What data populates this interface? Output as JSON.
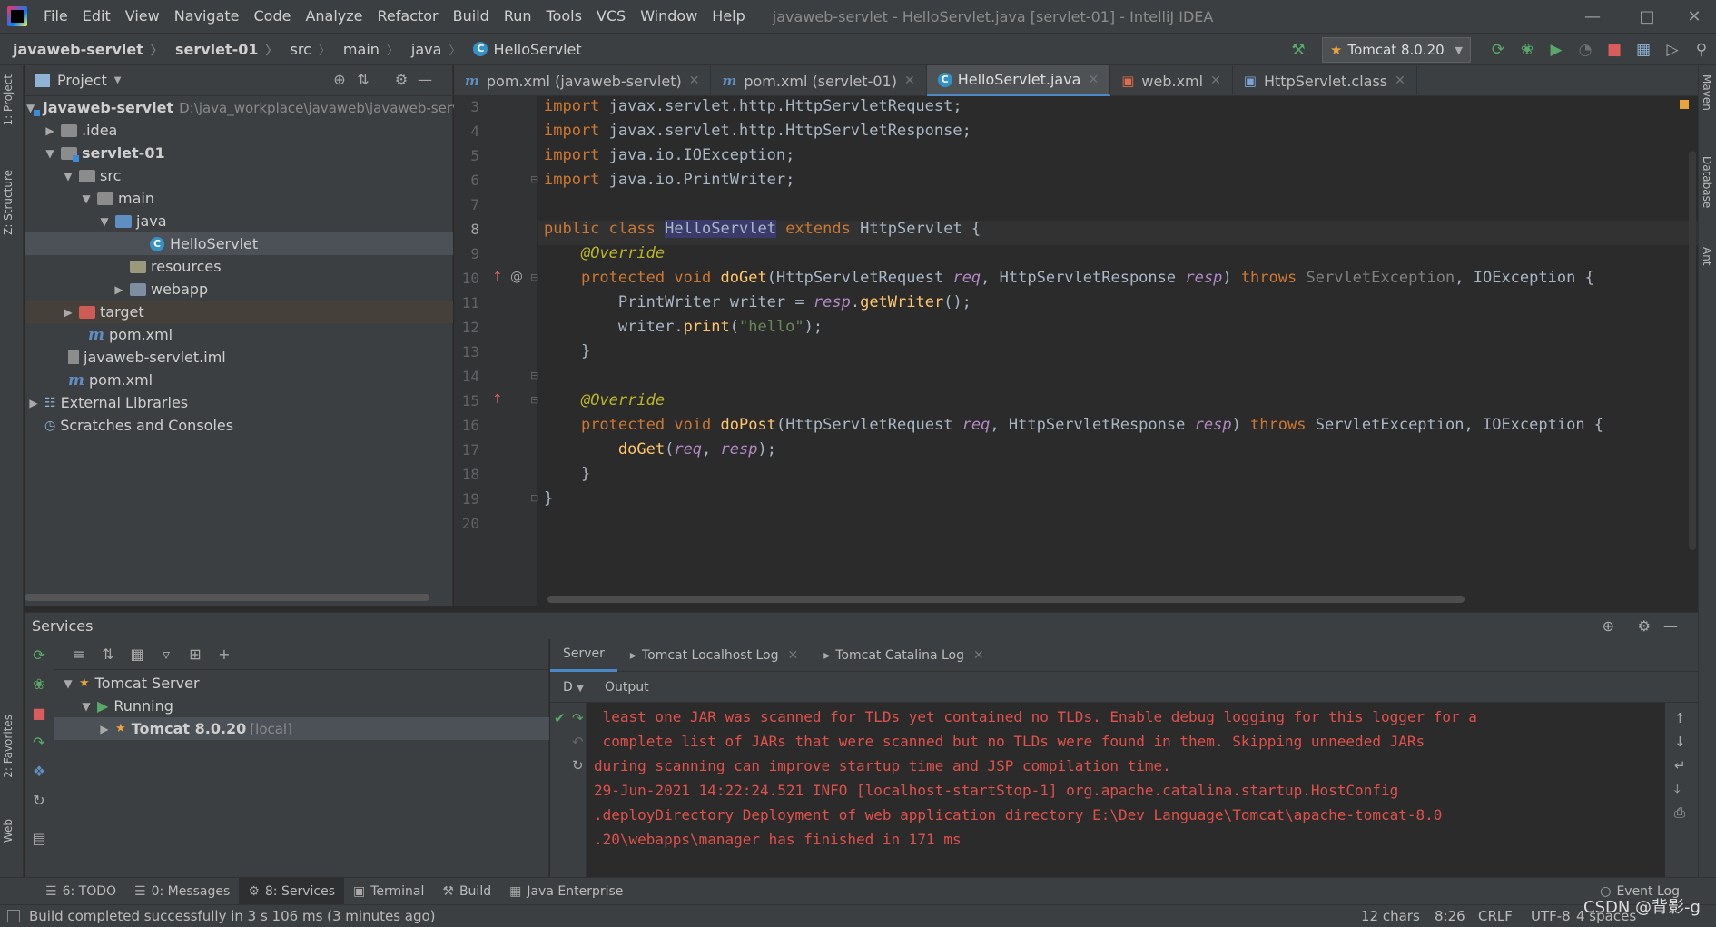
{
  "window": {
    "title": "javaweb-servlet - HelloServlet.java [servlet-01] - IntelliJ IDEA",
    "menu": [
      "File",
      "Edit",
      "View",
      "Navigate",
      "Code",
      "Analyze",
      "Refactor",
      "Build",
      "Run",
      "Tools",
      "VCS",
      "Window",
      "Help"
    ]
  },
  "breadcrumb": [
    "javaweb-servlet",
    "servlet-01",
    "src",
    "main",
    "java",
    "HelloServlet"
  ],
  "run_config": "Tomcat 8.0.20",
  "vertical_tabs": {
    "left": [
      "1: Project",
      "Z: Structure",
      "2: Favorites",
      "Web"
    ],
    "right": [
      "Maven",
      "Database",
      "Ant"
    ]
  },
  "project": {
    "header": "Project",
    "tree": [
      {
        "label": "javaweb-servlet",
        "path": "D:\\java_workplace\\javaweb\\javaweb-serv"
      },
      {
        "label": ".idea"
      },
      {
        "label": "servlet-01"
      },
      {
        "label": "src"
      },
      {
        "label": "main"
      },
      {
        "label": "java"
      },
      {
        "label": "HelloServlet"
      },
      {
        "label": "resources"
      },
      {
        "label": "webapp"
      },
      {
        "label": "target"
      },
      {
        "label": "pom.xml"
      },
      {
        "label": "javaweb-servlet.iml"
      },
      {
        "label": "pom.xml"
      },
      {
        "label": "External Libraries"
      },
      {
        "label": "Scratches and Consoles"
      }
    ]
  },
  "editor": {
    "tabs": [
      "pom.xml (javaweb-servlet)",
      "pom.xml (servlet-01)",
      "HelloServlet.java",
      "web.xml",
      "HttpServlet.class"
    ],
    "line_numbers": [
      "3",
      "4",
      "5",
      "6",
      "7",
      "8",
      "9",
      "10",
      "11",
      "12",
      "13",
      "14",
      "15",
      "16",
      "17",
      "18",
      "19",
      "20"
    ],
    "code": {
      "import1_pkg": "javax.servlet.http.HttpServletRequest",
      "import2_pkg": "javax.servlet.http.HttpServletResponse",
      "import3_pkg": "java.io.IOException",
      "import4_pkg": "java.io.PrintWriter",
      "kw_import": "import",
      "kw_public": "public",
      "kw_class": "class",
      "class_name": "HelloServlet",
      "kw_extends": "extends",
      "super_class": "HttpServlet",
      "override": "@Override",
      "kw_protected": "protected",
      "kw_void": "void",
      "do_get": "doGet",
      "do_post": "doPost",
      "req_type": "HttpServletRequest",
      "resp_type": "HttpServletResponse",
      "req": "req",
      "resp": "resp",
      "kw_throws": "throws",
      "servlet_exception": "ServletException",
      "io_exception": "IOException",
      "print_writer": "PrintWriter",
      "writer": "writer",
      "get_writer": "getWriter",
      "print": "print",
      "hello": "\"hello\""
    }
  },
  "services": {
    "title": "Services",
    "tree": [
      "Tomcat Server",
      "Running",
      "Tomcat 8.0.20"
    ],
    "local_suffix": "[local]",
    "tabs": [
      "Server",
      "Tomcat Localhost Log",
      "Tomcat Catalina Log"
    ],
    "output_label": "Output",
    "deploy_label": "D",
    "output_lines": [
      " least one JAR was scanned for TLDs yet contained no TLDs. Enable debug logging for this logger for a",
      " complete list of JARs that were scanned but no TLDs were found in them. Skipping unneeded JARs",
      "during scanning can improve startup time and JSP compilation time.",
      "29-Jun-2021 14:22:24.521 INFO [localhost-startStop-1] org.apache.catalina.startup.HostConfig",
      ".deployDirectory Deployment of web application directory E:\\Dev_Language\\Tomcat\\apache-tomcat-8.0",
      ".20\\webapps\\manager has finished in 171 ms"
    ]
  },
  "bottom_tabs": [
    "6: TODO",
    "0: Messages",
    "8: Services",
    "Terminal",
    "Build",
    "Java Enterprise"
  ],
  "event_log": "Event Log",
  "status": {
    "message": "Build completed successfully in 3 s 106 ms (3 minutes ago)",
    "chars": "12 chars",
    "position": "8:26",
    "line_sep": "CRLF",
    "encoding": "UTF-8",
    "indent": "4 spaces",
    "watermark": "CSDN @背影-g"
  },
  "colors": {
    "keyword": "#cc7832",
    "annotation": "#bbb529",
    "param": "#b389c5",
    "method": "#ffc66d",
    "string": "#6a8759",
    "output_error": "#e0514b",
    "accent": "#4a88c7"
  }
}
